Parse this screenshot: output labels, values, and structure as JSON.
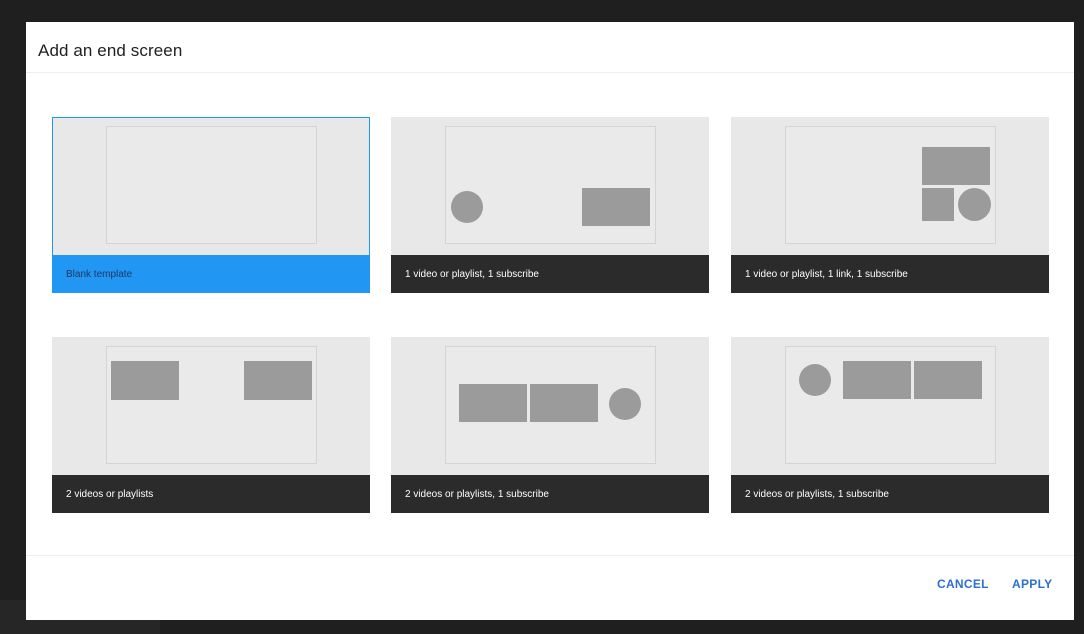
{
  "dialog": {
    "title": "Add an end screen"
  },
  "templates": [
    {
      "label": "Blank template",
      "selected": true
    },
    {
      "label": "1 video or playlist, 1 subscribe",
      "selected": false
    },
    {
      "label": "1 video or playlist, 1 link, 1 subscribe",
      "selected": false
    },
    {
      "label": "2 videos or playlists",
      "selected": false
    },
    {
      "label": "2 videos or playlists, 1 subscribe",
      "selected": false
    },
    {
      "label": "2 videos or playlists, 1 subscribe",
      "selected": false
    }
  ],
  "actions": {
    "cancel_label": "CANCEL",
    "apply_label": "APPLY"
  },
  "colors": {
    "accent": "#2196f3",
    "button_text": "#2b6fd1",
    "label_bar": "#2b2b2b",
    "element_placeholder": "#9b9b9b"
  }
}
